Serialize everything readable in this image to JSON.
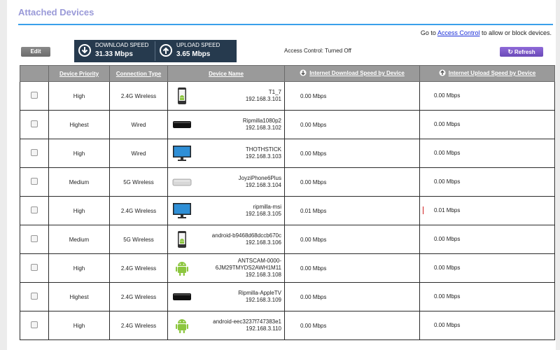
{
  "page": {
    "title": "Attached Devices",
    "goto_prefix": "Go to ",
    "goto_link": "Access Control",
    "goto_suffix": " to allow or block devices."
  },
  "toolbar": {
    "edit_label": "Edit",
    "refresh_label": "Refresh",
    "access_control_status": "Access Control: Turned Off"
  },
  "speed": {
    "download_label": "DOWNLOAD SPEED",
    "download_value": "31.33 Mbps",
    "upload_label": "UPLOAD SPEED",
    "upload_value": "3.65 Mbps"
  },
  "table": {
    "headers": {
      "priority": "Device Priority",
      "connection": "Connection Type",
      "name": "Device Name",
      "download": "Internet Download Speed by Device",
      "upload": "Internet Upload Speed by Device"
    },
    "rows": [
      {
        "priority": "High",
        "connection": "2.4G Wireless",
        "icon": "android-phone-icon",
        "name": "T1_7",
        "ip": "192.168.3.101",
        "down": "0.00 Mbps",
        "up": "0.00 Mbps"
      },
      {
        "priority": "Highest",
        "connection": "Wired",
        "icon": "apple-tv-icon",
        "name": "Ripmilla1080p2",
        "ip": "192.168.3.102",
        "down": "0.00 Mbps",
        "up": "0.00 Mbps"
      },
      {
        "priority": "High",
        "connection": "Wired",
        "icon": "monitor-icon",
        "name": "THOTHSTICK",
        "ip": "192.168.3.103",
        "down": "0.00 Mbps",
        "up": "0.00 Mbps"
      },
      {
        "priority": "Medium",
        "connection": "5G Wireless",
        "icon": "mac-mini-icon",
        "name": "JoyziPhone6Plus",
        "ip": "192.168.3.104",
        "down": "0.00 Mbps",
        "up": "0.00 Mbps"
      },
      {
        "priority": "High",
        "connection": "2.4G Wireless",
        "icon": "monitor-icon",
        "name": "ripmilla-msi",
        "ip": "192.168.3.105",
        "down": "0.01 Mbps",
        "up": "0.01 Mbps"
      },
      {
        "priority": "Medium",
        "connection": "5G Wireless",
        "icon": "android-phone-icon",
        "name": "android-b9468d68dccb670c",
        "ip": "192.168.3.106",
        "down": "0.00 Mbps",
        "up": "0.00 Mbps"
      },
      {
        "priority": "High",
        "connection": "2.4G Wireless",
        "icon": "android-robot-icon",
        "name": "ANTSCAM-0000-\n6JM29TMYDS2AWH1M11",
        "ip": "192.168.3.108",
        "down": "0.00 Mbps",
        "up": "0.00 Mbps"
      },
      {
        "priority": "Highest",
        "connection": "2.4G Wireless",
        "icon": "apple-tv-icon",
        "name": "Ripmilla-AppleTV",
        "ip": "192.168.3.109",
        "down": "0.00 Mbps",
        "up": "0.00 Mbps"
      },
      {
        "priority": "High",
        "connection": "2.4G Wireless",
        "icon": "android-robot-icon",
        "name": "android-eec3237f747383e1",
        "ip": "192.168.3.110",
        "down": "0.00 Mbps",
        "up": "0.00 Mbps"
      }
    ]
  },
  "colors": {
    "title": "#9a9ad8",
    "rule": "#3aa0ea",
    "speed_box": "#263a4e",
    "refresh": "#7a5ac8",
    "header": "#9a9a9a"
  }
}
